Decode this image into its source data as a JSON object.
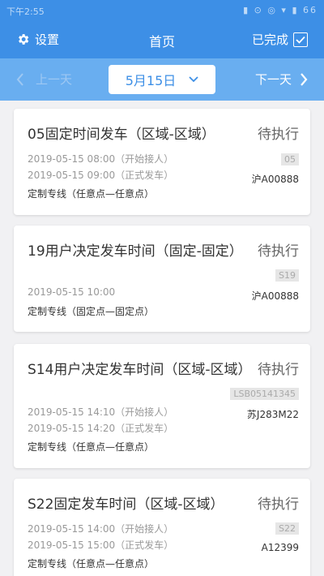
{
  "statusbar": {
    "time": "下午2:55",
    "icons": "▮ ⊙ ◎ ▾ ▮ 66"
  },
  "header": {
    "settings_label": "设置",
    "title": "首页",
    "done_label": "已完成"
  },
  "datebar": {
    "prev_label": "上一天",
    "date": "5月15日",
    "next_label": "下一天"
  },
  "trips": [
    {
      "title": "05固定时间发车（区域-区域）",
      "status": "待执行",
      "code": "05",
      "plate": "沪A00888",
      "lines": [
        "2019-05-15 08:00（开始接人）",
        "2019-05-15 09:00（正式发车）"
      ],
      "route": "定制专线（任意点—任意点）"
    },
    {
      "title": "19用户决定发车时间（固定-固定）",
      "status": "待执行",
      "code": "S19",
      "plate": "沪A00888",
      "lines": [
        "2019-05-15 10:00"
      ],
      "route": "定制专线（固定点—固定点）"
    },
    {
      "title": "S14用户决定发车时间（区域-区域）",
      "status": "待执行",
      "code": "LSB05141345",
      "plate": "苏J283M22",
      "lines": [
        "2019-05-15 14:10（开始接人）",
        "2019-05-15 14:20（正式发车）"
      ],
      "route": "定制专线（任意点—任意点）"
    },
    {
      "title": "S22固定发车时间（区域-区域）",
      "status": "待执行",
      "code": "S22",
      "plate": "A12399",
      "lines": [
        "2019-05-15 14:00（开始接人）",
        "2019-05-15 15:00（正式发车）"
      ],
      "route": "定制专线（任意点—任意点）"
    }
  ]
}
